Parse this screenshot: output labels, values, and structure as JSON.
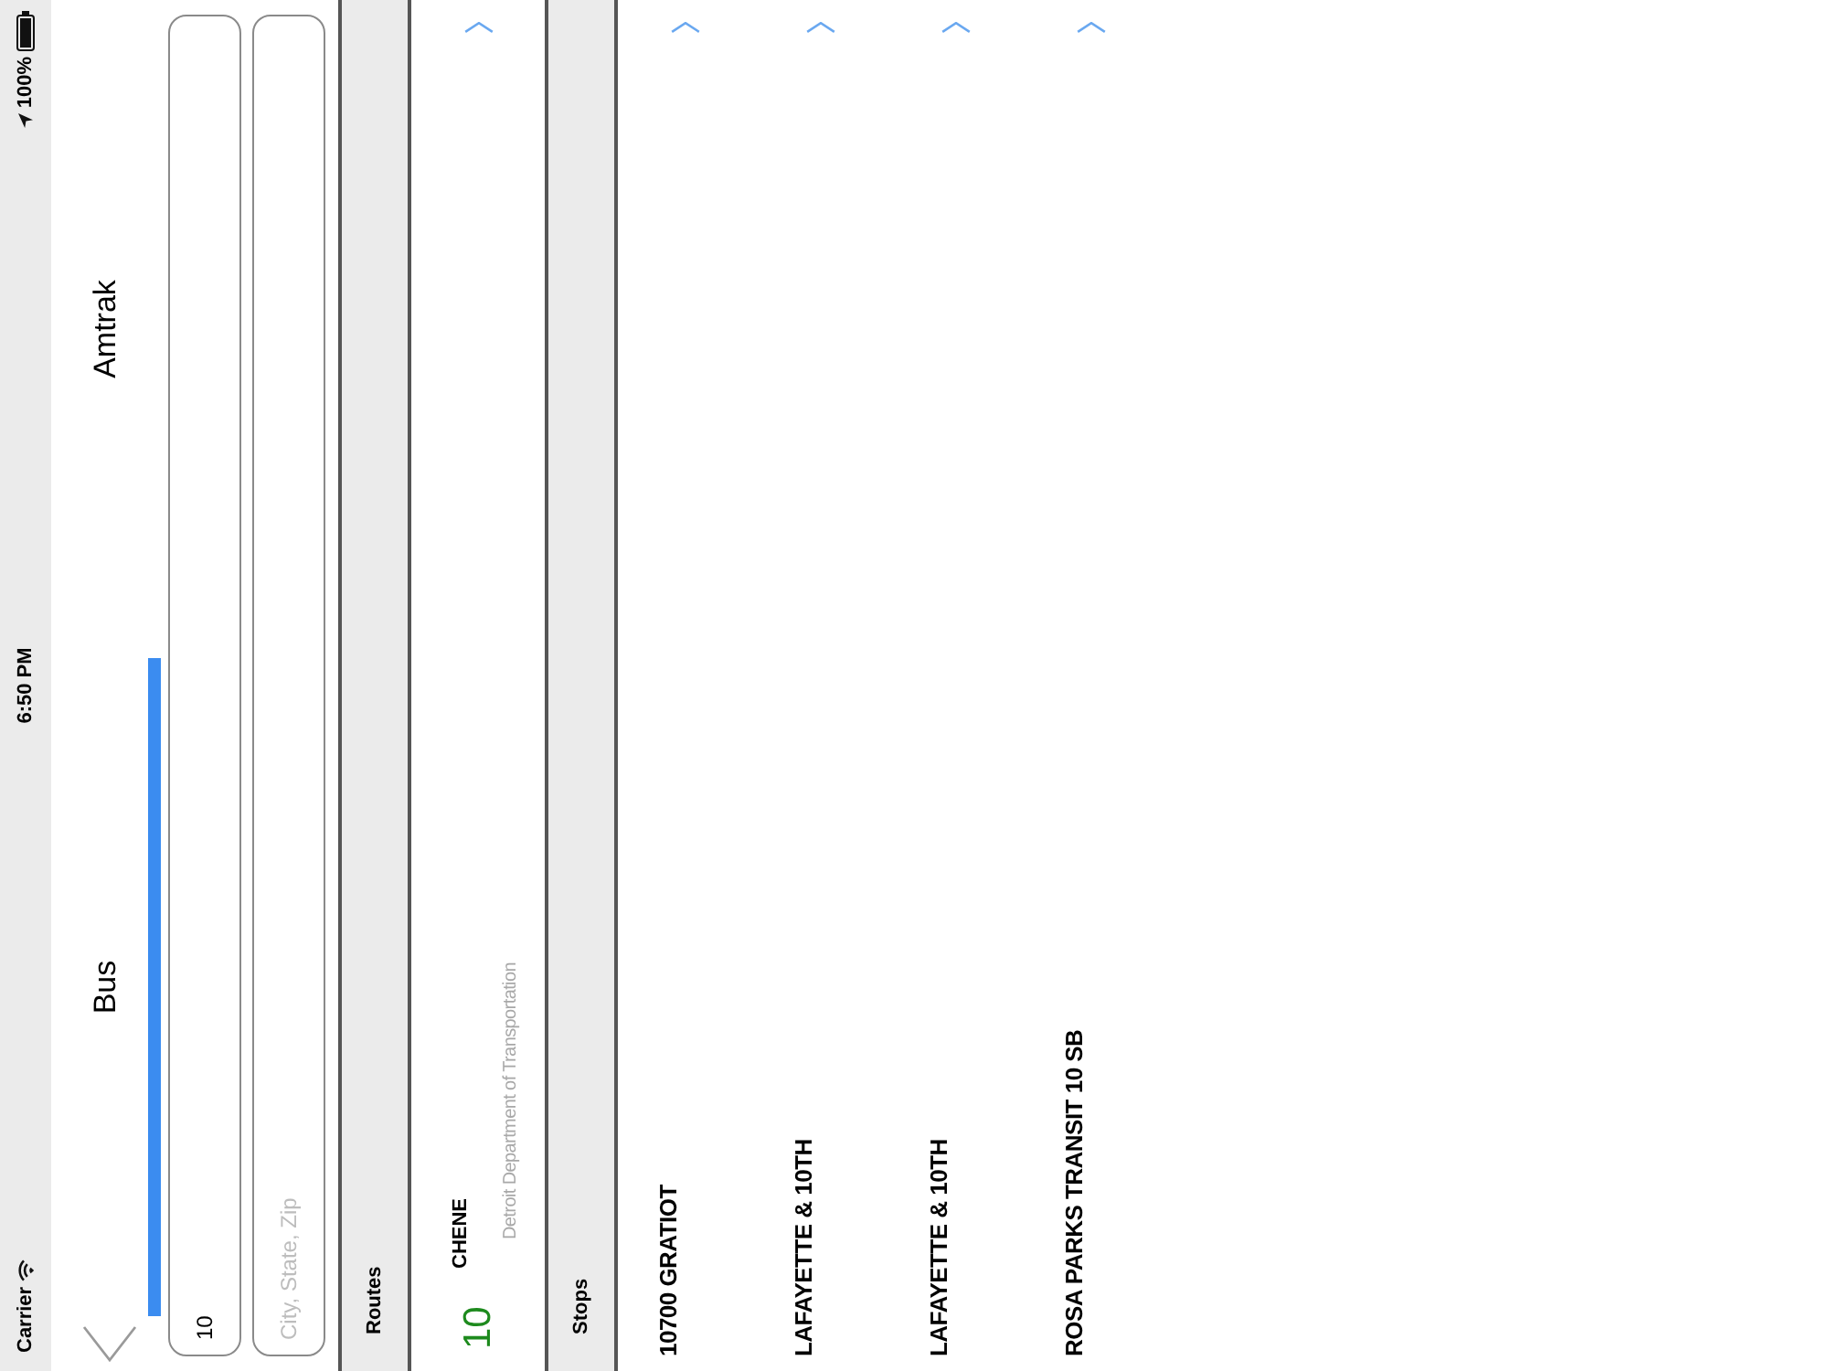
{
  "status_bar": {
    "carrier": "Carrier",
    "time": "6:50 PM",
    "battery": "100%"
  },
  "tabs": [
    {
      "label": "Bus",
      "selected": true
    },
    {
      "label": "Amtrak",
      "selected": false
    }
  ],
  "search_fields": [
    {
      "value": "10"
    },
    {
      "placeholder": "City, State, Zip"
    }
  ],
  "sections": [
    {
      "title": "Routes",
      "kind": "routes",
      "items": [
        {
          "number": "10",
          "name": "CHENE",
          "agency": "Detroit Department of Transportation"
        }
      ]
    },
    {
      "title": "Stops",
      "kind": "stops",
      "items": [
        {
          "name": "10700 GRATIOT"
        },
        {
          "name": "LAFAYETTE & 10TH"
        },
        {
          "name": "LAFAYETTE & 10TH"
        },
        {
          "name": "ROSA PARKS TRANSIT 10 SB"
        }
      ]
    }
  ]
}
